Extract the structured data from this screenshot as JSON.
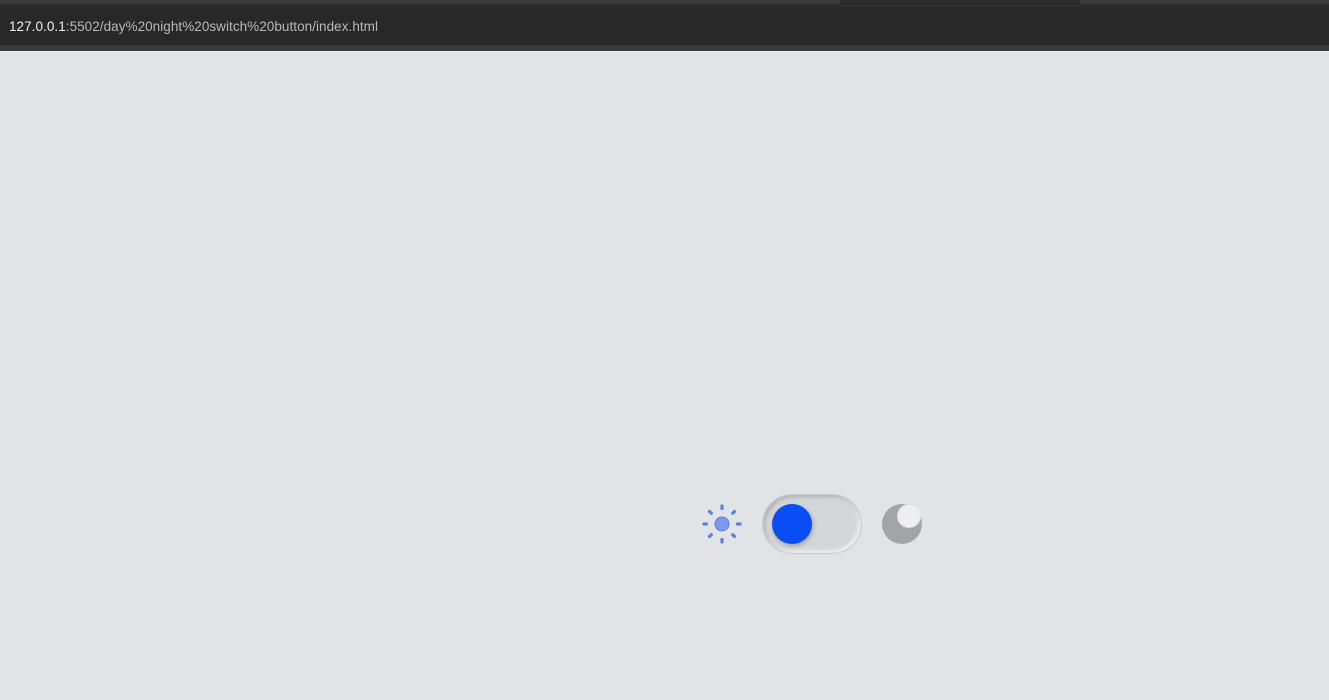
{
  "browser": {
    "url_host": "127.0.0.1",
    "url_rest": ":5502/day%20night%20switch%20button/index.html"
  },
  "page": {
    "background": "#e2e3e7",
    "toggle": {
      "state": "day",
      "checked": false,
      "knob_color": "#0a4df2",
      "track_color": "#d4d5d9",
      "sun_icon": "sun-icon",
      "moon_icon": "moon-icon",
      "sun_color": "#5b7fe0",
      "moon_color": "#a3a4a8"
    }
  }
}
